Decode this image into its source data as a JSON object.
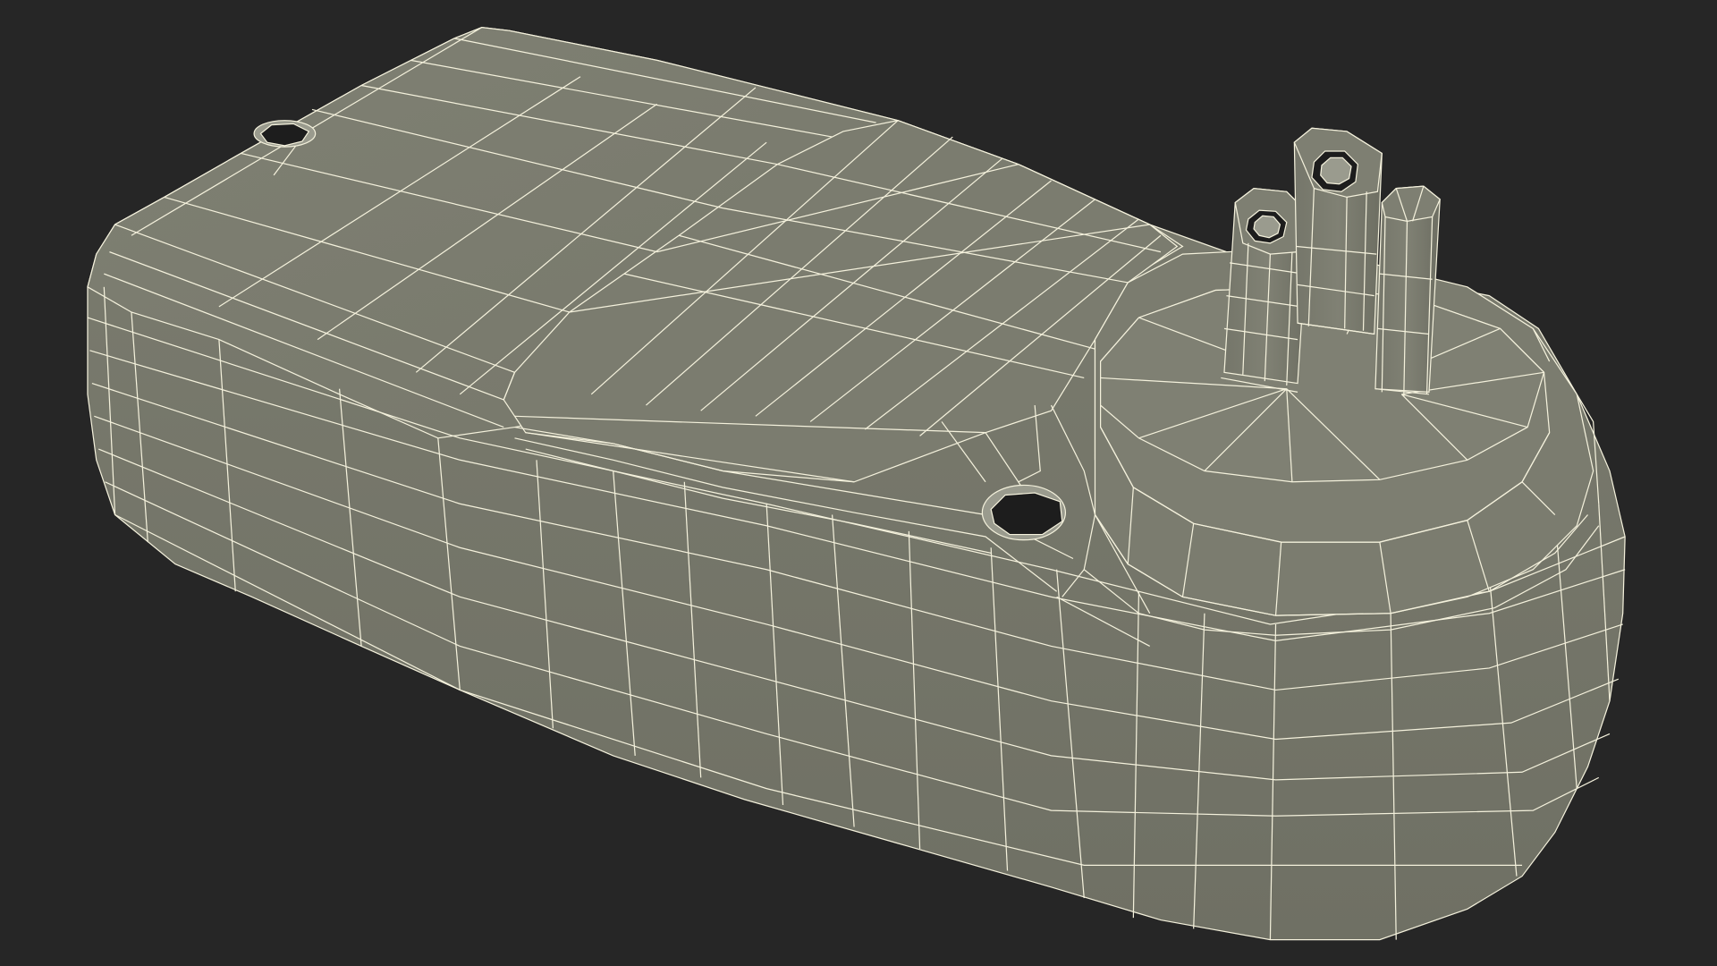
{
  "scene": {
    "background": "#262626",
    "body_fill": "#7a7b6e",
    "body_shade": "#6e6f63",
    "top_fill": "#7e7f72",
    "wire_color": "#f4f1dc",
    "hole_fill": "#1d1d1d",
    "hole_rim": "#9a9b8e",
    "object": "wireframe-plug-adapter-model",
    "features": [
      "mounting-hole-left",
      "mounting-hole-center",
      "round-plug-base",
      "prong-left",
      "prong-center",
      "prong-ground"
    ]
  }
}
